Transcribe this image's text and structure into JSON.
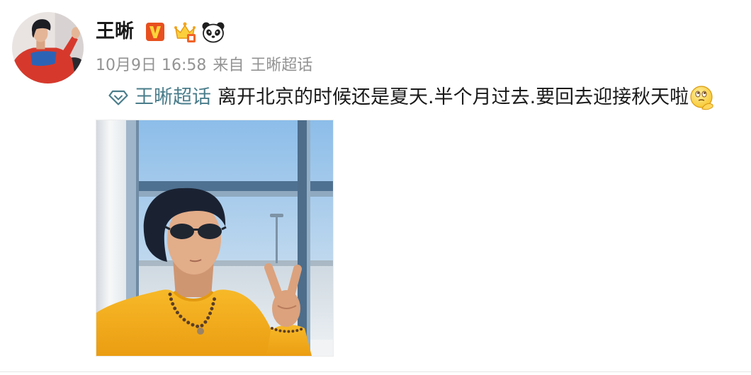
{
  "post": {
    "author": {
      "name": "王晰",
      "avatar_icon": "avatar-photo",
      "badges": [
        "verified-v-icon",
        "member-crown-icon",
        "panda-icon"
      ]
    },
    "meta": {
      "time": "10月9日 16:58",
      "source_prefix": "来自",
      "source": "王晰超话"
    },
    "content": {
      "topic_icon": "super-topic-diamond-icon",
      "topic_link": "王晰超话",
      "text": "离开北京的时候还是夏天.半个月过去.要回去迎接秋天啦",
      "emoji": "thinking-face-emoji"
    },
    "image": {
      "icon": "post-photo"
    }
  },
  "colors": {
    "name": "#1a1a1a",
    "meta": "#939393",
    "topic_link": "#4a7d8b",
    "text": "#1a1a1a",
    "divider": "#e6e6e6",
    "verified_badge": "#e8501f"
  }
}
